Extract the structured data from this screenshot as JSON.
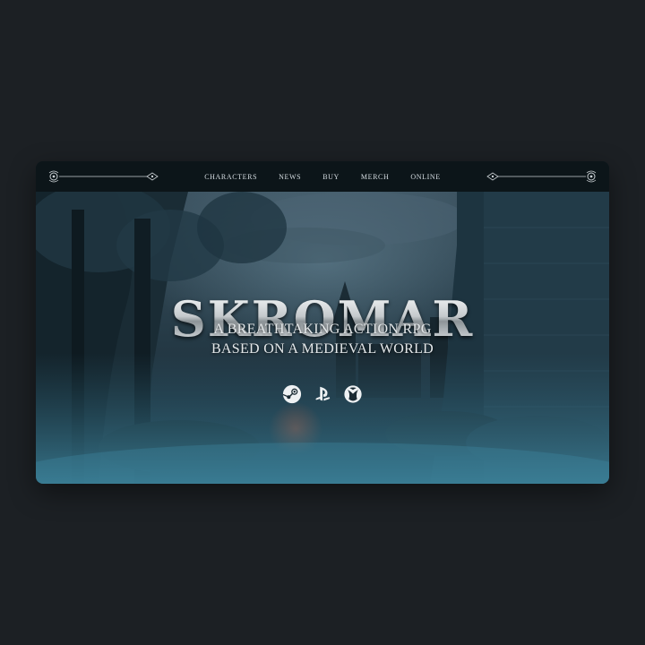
{
  "nav": {
    "items": [
      {
        "label": "CHARACTERS"
      },
      {
        "label": "NEWS"
      },
      {
        "label": "BUY"
      },
      {
        "label": "MERCH"
      },
      {
        "label": "ONLINE"
      }
    ]
  },
  "hero": {
    "title": "SKROMAR",
    "tagline_line1": "A BREATHTAKING ACTION RPG",
    "tagline_line2": "BASED ON A MEDIEVAL WORLD",
    "platforms": [
      {
        "icon": "steam-icon"
      },
      {
        "icon": "playstation-icon"
      },
      {
        "icon": "xbox-icon"
      }
    ]
  },
  "colors": {
    "page_background": "#1c2024",
    "navbar_background": "#0c1519",
    "hero_tone": "#2a4a5a",
    "text": "#e4e8ea"
  }
}
